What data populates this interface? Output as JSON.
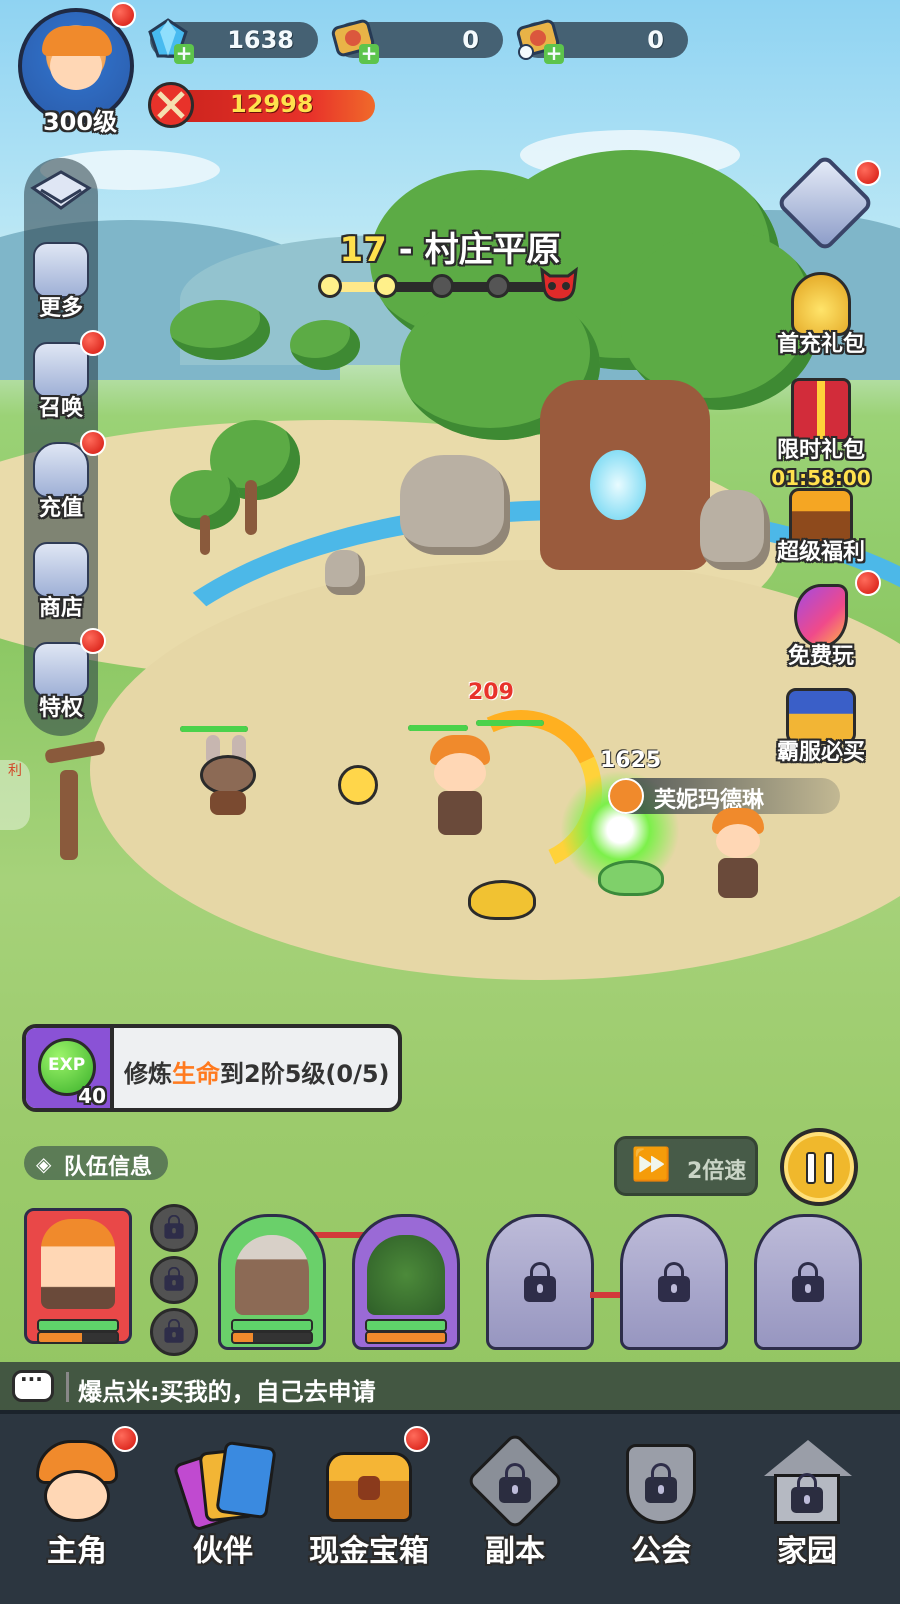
{
  "player": {
    "level": "300级"
  },
  "resources": {
    "gems": "1638",
    "tickets": "0",
    "timed_tickets": "0",
    "power": "12998"
  },
  "stage": {
    "number": "17",
    "separator": " - ",
    "name": "村庄平原",
    "progress_nodes": 5,
    "progress_reached": 2
  },
  "left_menu": {
    "more": "更多",
    "summon": "召唤",
    "recharge": "充值",
    "shop": "商店",
    "privilege": "特权"
  },
  "right_menu": {
    "first_recharge": "首充礼包",
    "limited_pack": "限时礼包",
    "limited_timer": "01:58:00",
    "super_welfare": "超级福利",
    "free_play": "免费玩",
    "must_buy": "霸服必买"
  },
  "battle": {
    "damage_1": "209",
    "damage_2": "1625",
    "ally_name": "芙妮玛德琳",
    "side_tag": "利"
  },
  "quest": {
    "exp_label": "EXP",
    "exp_amount": "40",
    "text_prefix": "修炼",
    "text_highlight": "生命",
    "text_suffix": "到2阶5级(0/5)"
  },
  "team": {
    "info_label": "队伍信息",
    "speed_label": "2倍速"
  },
  "chat": {
    "message": "爆点米:买我的，自己去申请"
  },
  "nav": {
    "hero": "主角",
    "partner": "伙伴",
    "cash_chest": "现金宝箱",
    "dungeon": "副本",
    "guild": "公会",
    "home": "家园"
  },
  "colors": {
    "highlight": "#ff7a1f",
    "stage_number": "#ffe14d",
    "power_bar": "#e8322a",
    "speed_btn": "#3f4f45"
  }
}
